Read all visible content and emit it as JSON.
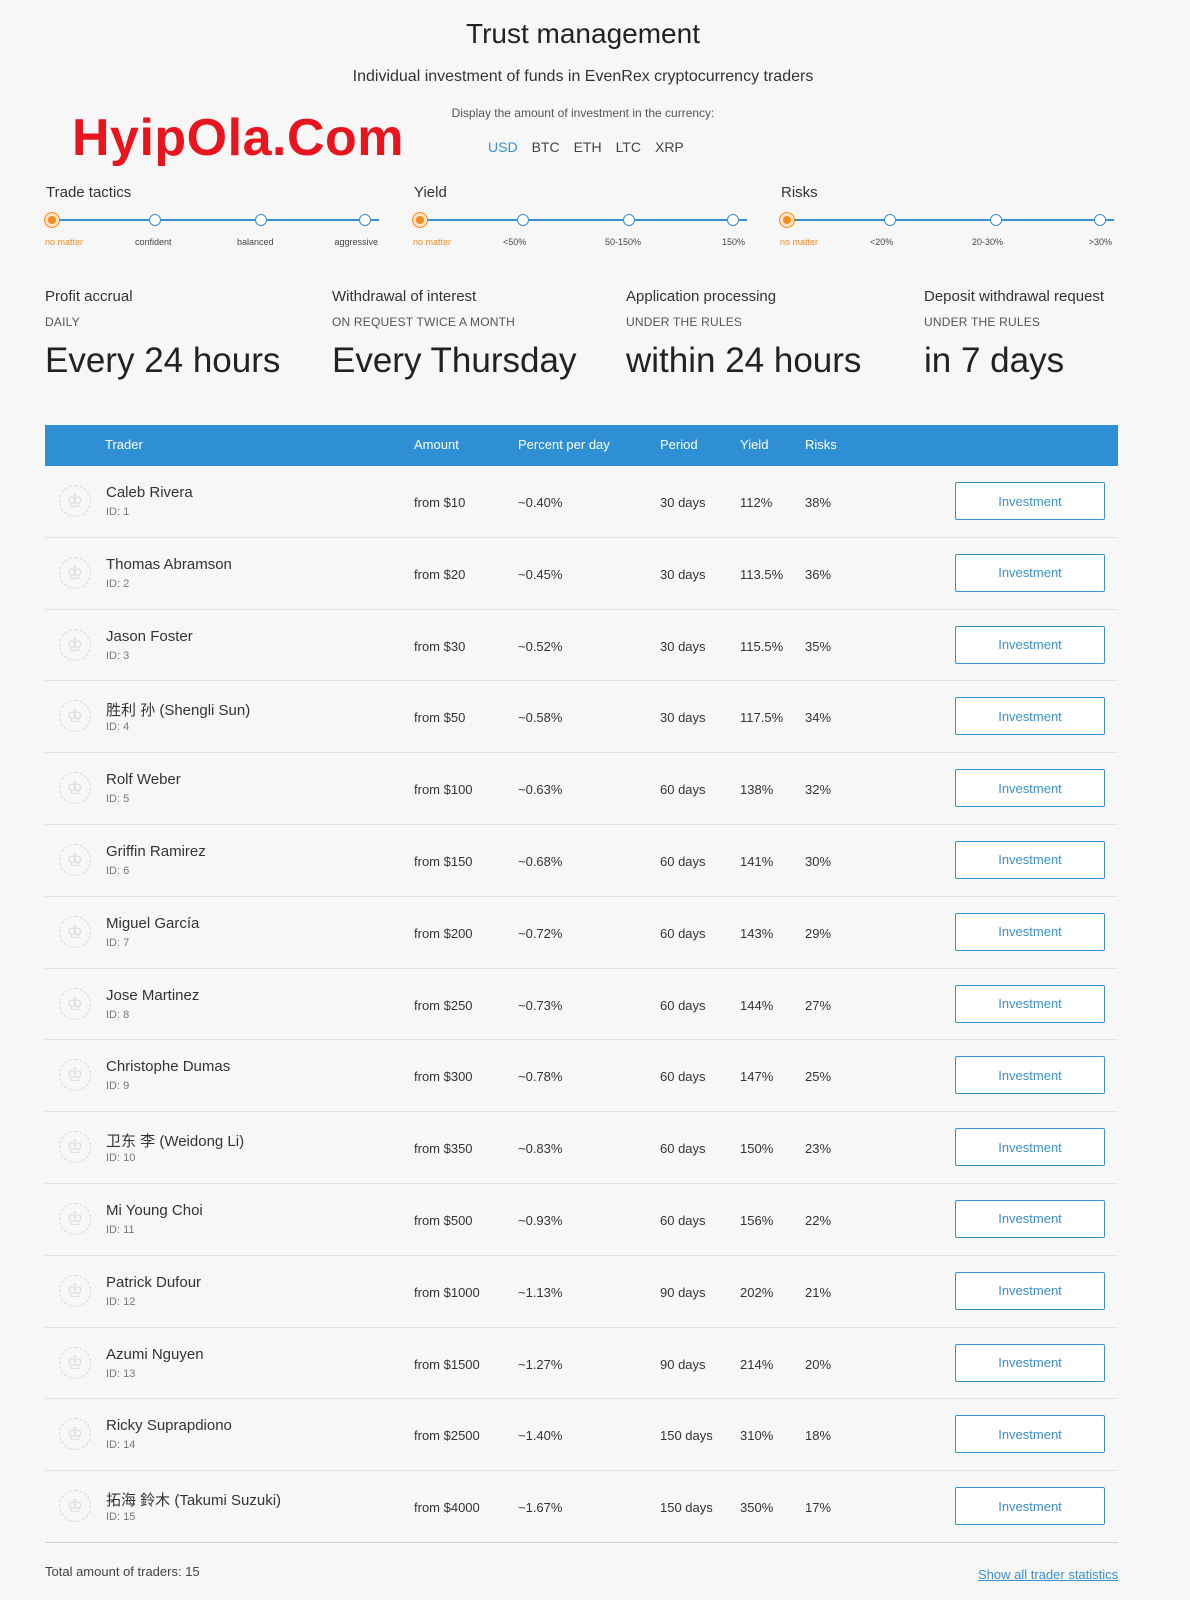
{
  "header": {
    "title": "Trust management",
    "subtitle": "Individual investment of funds in EvenRex cryptocurrency traders",
    "currency_label": "Display the amount of investment in the currency:",
    "watermark": "HyipOla.Com",
    "currencies": [
      "USD",
      "BTC",
      "ETH",
      "LTC",
      "XRP"
    ],
    "active_currency": "USD"
  },
  "filters": [
    {
      "title": "Trade tactics",
      "options": [
        "no matter",
        "confident",
        "balanced",
        "aggressive"
      ],
      "selected": "no matter"
    },
    {
      "title": "Yield",
      "options": [
        "no matter",
        "<50%",
        "50-150%",
        "150%"
      ],
      "selected": "no matter"
    },
    {
      "title": "Risks",
      "options": [
        "no matter",
        "<20%",
        "20-30%",
        ">30%"
      ],
      "selected": "no matter"
    }
  ],
  "stats": [
    {
      "label": "Profit accrual",
      "sub": "DAILY",
      "value": "Every 24 hours"
    },
    {
      "label": "Withdrawal of interest",
      "sub": "ON REQUEST TWICE A MONTH",
      "value": "Every Thursday"
    },
    {
      "label": "Application processing",
      "sub": "UNDER THE RULES",
      "value": "within 24 hours"
    },
    {
      "label": "Deposit withdrawal request",
      "sub": "UNDER THE RULES",
      "value": "in 7 days"
    }
  ],
  "table": {
    "headers": {
      "trader": "Trader",
      "amount": "Amount",
      "percent": "Percent per day",
      "period": "Period",
      "yield": "Yield",
      "risks": "Risks"
    },
    "button_label": "Investment",
    "rows": [
      {
        "name": "Caleb Rivera",
        "id": "ID: 1",
        "amount": "from $10",
        "percent": "~0.40%",
        "period": "30 days",
        "yield": "112%",
        "risks": "38%"
      },
      {
        "name": "Thomas Abramson",
        "id": "ID: 2",
        "amount": "from $20",
        "percent": "~0.45%",
        "period": "30 days",
        "yield": "113.5%",
        "risks": "36%"
      },
      {
        "name": "Jason Foster",
        "id": "ID: 3",
        "amount": "from $30",
        "percent": "~0.52%",
        "period": "30 days",
        "yield": "115.5%",
        "risks": "35%"
      },
      {
        "name": "胜利 孙 (Shengli Sun)",
        "id": "ID: 4",
        "amount": "from $50",
        "percent": "~0.58%",
        "period": "30 days",
        "yield": "117.5%",
        "risks": "34%"
      },
      {
        "name": "Rolf Weber",
        "id": "ID: 5",
        "amount": "from $100",
        "percent": "~0.63%",
        "period": "60 days",
        "yield": "138%",
        "risks": "32%"
      },
      {
        "name": "Griffin Ramirez",
        "id": "ID: 6",
        "amount": "from $150",
        "percent": "~0.68%",
        "period": "60 days",
        "yield": "141%",
        "risks": "30%"
      },
      {
        "name": "Miguel García",
        "id": "ID: 7",
        "amount": "from $200",
        "percent": "~0.72%",
        "period": "60 days",
        "yield": "143%",
        "risks": "29%"
      },
      {
        "name": "Jose Martinez",
        "id": "ID: 8",
        "amount": "from $250",
        "percent": "~0.73%",
        "period": "60 days",
        "yield": "144%",
        "risks": "27%"
      },
      {
        "name": "Christophe Dumas",
        "id": "ID: 9",
        "amount": "from $300",
        "percent": "~0.78%",
        "period": "60 days",
        "yield": "147%",
        "risks": "25%"
      },
      {
        "name": "卫东 李 (Weidong Li)",
        "id": "ID: 10",
        "amount": "from $350",
        "percent": "~0.83%",
        "period": "60 days",
        "yield": "150%",
        "risks": "23%"
      },
      {
        "name": "Mi Young Choi",
        "id": "ID: 11",
        "amount": "from $500",
        "percent": "~0.93%",
        "period": "60 days",
        "yield": "156%",
        "risks": "22%"
      },
      {
        "name": "Patrick Dufour",
        "id": "ID: 12",
        "amount": "from $1000",
        "percent": "~1.13%",
        "period": "90 days",
        "yield": "202%",
        "risks": "21%"
      },
      {
        "name": "Azumi Nguyen",
        "id": "ID: 13",
        "amount": "from $1500",
        "percent": "~1.27%",
        "period": "90 days",
        "yield": "214%",
        "risks": "20%"
      },
      {
        "name": "Ricky Suprapdiono",
        "id": "ID: 14",
        "amount": "from $2500",
        "percent": "~1.40%",
        "period": "150 days",
        "yield": "310%",
        "risks": "18%"
      },
      {
        "name": "拓海 鈴木 (Takumi Suzuki)",
        "id": "ID: 15",
        "amount": "from $4000",
        "percent": "~1.67%",
        "period": "150 days",
        "yield": "350%",
        "risks": "17%"
      }
    ]
  },
  "footer": {
    "total_label": "Total amount of traders:",
    "total_count": "15",
    "show_all": "Show all trader statistics"
  },
  "colors": {
    "accent": "#2e8fd4",
    "selected": "#f58a1f",
    "watermark": "#e8141e"
  }
}
